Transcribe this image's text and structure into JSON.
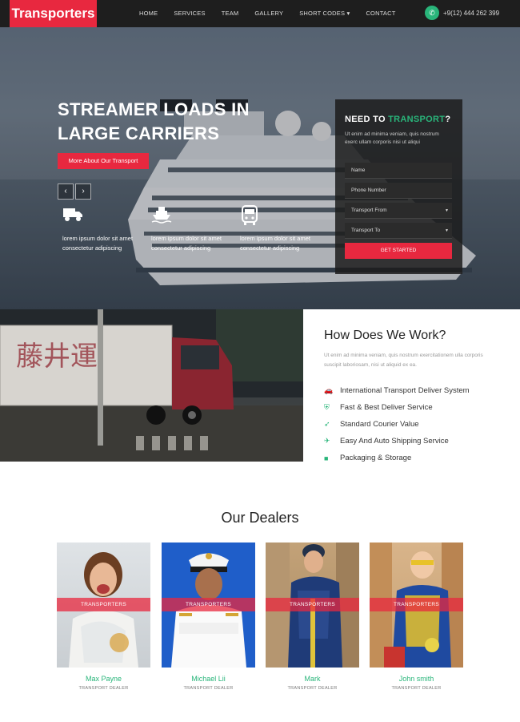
{
  "brand": {
    "name": "Transporters",
    "accent": "#e8283f",
    "green": "#29b57a"
  },
  "nav": {
    "items": [
      "HOME",
      "SERVICES",
      "TEAM",
      "GALLERY",
      "SHORT CODES",
      "CONTACT"
    ],
    "phone": "+9(12) 444 262 399",
    "phone_icon": "phone-icon"
  },
  "hero": {
    "title_line1": "STREAMER LOADS IN",
    "title_line2": "LARGE CARRIERS",
    "button": "More About Our Transport",
    "features": [
      {
        "icon": "truck-icon",
        "text": "lorem ipsum dolor sit amet consectetur adipiscing"
      },
      {
        "icon": "ship-icon",
        "text": "lorem ipsum dolor sit amet consectetur adipiscing"
      },
      {
        "icon": "bus-icon",
        "text": "lorem ipsum dolor sit amet consectetur adipiscing"
      }
    ]
  },
  "form": {
    "title_prefix": "NEED TO",
    "title_highlight": "TRANSPORT",
    "title_suffix": "?",
    "desc": "Ut enim ad minima veniam, quis nostrum exerc ullam corporis nisi ut aliqui",
    "name_placeholder": "Name",
    "phone_placeholder": "Phone Number",
    "from_label": "Transport From",
    "to_label": "Transport To",
    "submit": "GET STARTED"
  },
  "how": {
    "title": "How Does We Work?",
    "desc": "Ut enim ad minima veniam, quis nostrum exercitationem ulla corporis suscipit laboriosam, nisi ut aliquid ex ea.",
    "items": [
      {
        "icon": "car-icon",
        "label": "International Transport Deliver System"
      },
      {
        "icon": "shield-icon",
        "label": "Fast & Best Deliver Service"
      },
      {
        "icon": "rocket-icon",
        "label": "Standard Courier Value"
      },
      {
        "icon": "plane-icon",
        "label": "Easy And Auto Shipping Service"
      },
      {
        "icon": "truck-icon",
        "label": "Packaging & Storage"
      }
    ]
  },
  "dealers": {
    "title": "Our Dealers",
    "band": "TRANSPORTERS",
    "list": [
      {
        "name": "Max Payne",
        "role": "TRANSPORT DEALER"
      },
      {
        "name": "Michael Lii",
        "role": "TRANSPORT DEALER"
      },
      {
        "name": "Mark",
        "role": "TRANSPORT DEALER"
      },
      {
        "name": "John smith",
        "role": "TRANSPORT DEALER"
      }
    ]
  }
}
